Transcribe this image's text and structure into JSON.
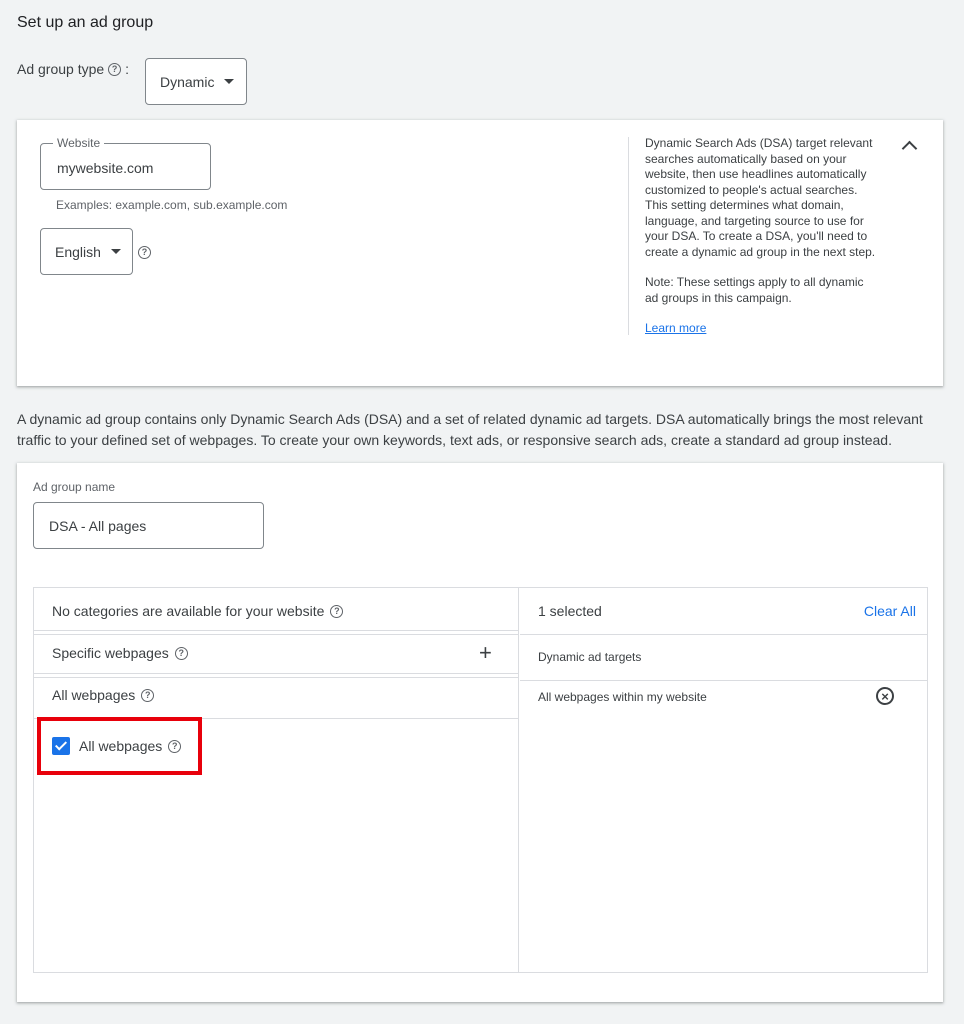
{
  "page": {
    "title": "Set up an ad group"
  },
  "ad_group_type": {
    "label": "Ad group type",
    "colon": ":",
    "selected": "Dynamic"
  },
  "dsa_settings": {
    "website_label": "Website",
    "website_value": "mywebsite.com",
    "website_hint": "Examples: example.com, sub.example.com",
    "language_selected": "English",
    "info_lines": [
      "Dynamic Search Ads (DSA) target relevant",
      "searches automatically based on your",
      "website, then use headlines automatically",
      "customized to people's actual searches.",
      "This setting determines what domain,",
      "language, and targeting source to use for",
      "your DSA. To create a DSA, you'll need to",
      "create a dynamic ad group in the next step."
    ],
    "note_lines": [
      "Note: These settings apply to all dynamic",
      "ad groups in this campaign."
    ],
    "learn_more": "Learn more"
  },
  "description": {
    "line1": "A dynamic ad group contains only Dynamic Search Ads (DSA) and a set of related dynamic ad targets. DSA automatically brings the most relevant",
    "line2": "traffic to your defined set of webpages. To create your own keywords, text ads, or responsive search ads, create a standard ad group instead."
  },
  "ad_group": {
    "name_label": "Ad group name",
    "name_value": "DSA - All pages"
  },
  "targets_left": {
    "no_categories": "No categories are available for your website",
    "specific_webpages": "Specific webpages",
    "all_webpages_header": "All webpages",
    "all_webpages_option": "All webpages",
    "all_webpages_checked": true
  },
  "targets_right": {
    "selected_count": "1 selected",
    "clear_all": "Clear All",
    "column_header": "Dynamic ad targets",
    "items": [
      "All webpages within my website"
    ]
  },
  "colors": {
    "accent": "#1a73e8",
    "highlight": "#e8000b"
  }
}
